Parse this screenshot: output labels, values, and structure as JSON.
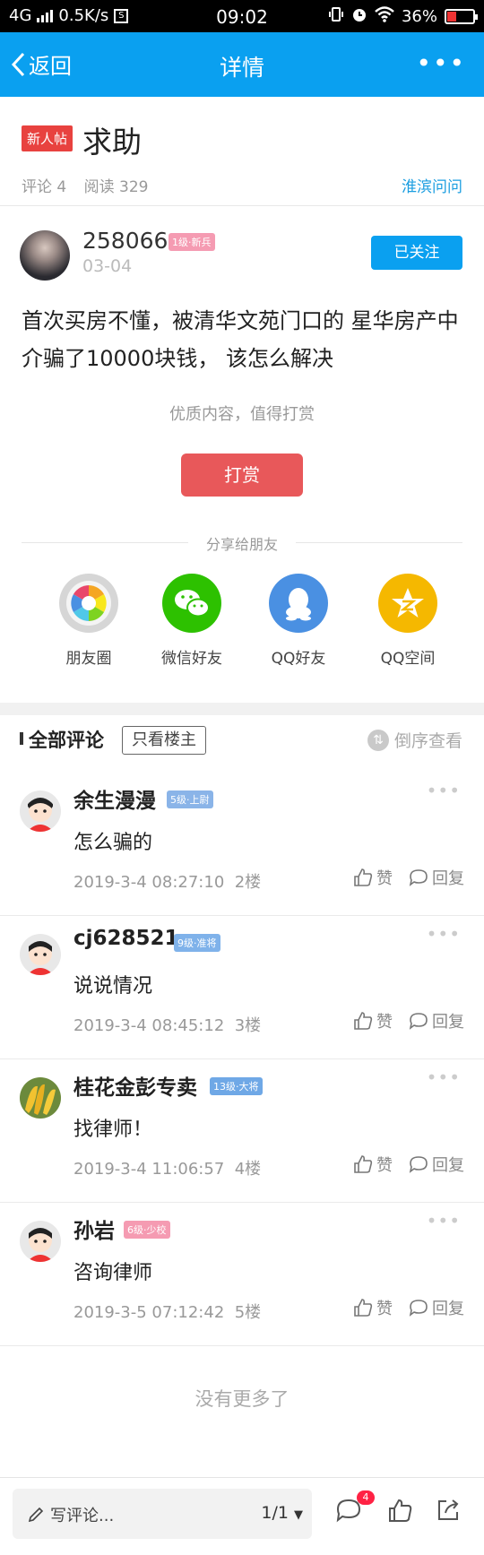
{
  "status_bar": {
    "network": "4G",
    "speed": "0.5K/s",
    "sbox": "S",
    "time": "09:02",
    "battery": "36%",
    "battery_level": 0.36
  },
  "nav": {
    "back_label": "返回",
    "title": "详情",
    "more_label": "•••"
  },
  "post": {
    "tag": "新人帖",
    "title": "求助",
    "comments_meta": "评论 4",
    "reads_meta": "阅读 329",
    "forum": "淮滨问问",
    "author": {
      "name": "258066",
      "level": "1级·新兵",
      "date": "03-04",
      "follow_label": "已关注"
    },
    "body": "首次买房不懂，被清华文苑门口的  星华房产中介骗了10000块钱，  该怎么解决",
    "reward_hint": "优质内容，值得打赏",
    "reward_label": "打赏"
  },
  "share": {
    "label": "分享给朋友",
    "items": [
      {
        "label": "朋友圈",
        "icon": "moments-icon",
        "color": "#d0d0d0"
      },
      {
        "label": "微信好友",
        "icon": "wechat-icon",
        "color": "#2dc100"
      },
      {
        "label": "QQ好友",
        "icon": "qq-icon",
        "color": "#4a90e2"
      },
      {
        "label": "QQ空间",
        "icon": "qzone-icon",
        "color": "#f5b800"
      }
    ]
  },
  "comments": {
    "title": "全部评论",
    "op_only_label": "只看楼主",
    "reverse_label": "倒序查看",
    "like_label": "赞",
    "reply_label": "回复",
    "more_label": "•••",
    "items": [
      {
        "name": "余生漫漫",
        "level": "5级·上尉",
        "level_color": "#8ab4e8",
        "text": "怎么骗的",
        "time": "2019-3-4 08:27:10",
        "floor": "2楼"
      },
      {
        "name": "cj628521",
        "level": "9级·准将",
        "level_color": "#7fb2ea",
        "text": "说说情况",
        "time": "2019-3-4 08:45:12",
        "floor": "3楼"
      },
      {
        "name": "桂花金彭专卖",
        "level": "13级·大将",
        "level_color": "#6fa8e6",
        "text": "找律师！",
        "time": "2019-3-4 11:06:57",
        "floor": "4楼"
      },
      {
        "name": "孙岩",
        "level": "6级·少校",
        "level_color": "#f59bb2",
        "text": "咨询律师",
        "time": "2019-3-5 07:12:42",
        "floor": "5楼"
      }
    ],
    "no_more": "没有更多了"
  },
  "bottom_bar": {
    "write_placeholder": "写评论...",
    "page": "1/1",
    "comment_count": "4"
  }
}
